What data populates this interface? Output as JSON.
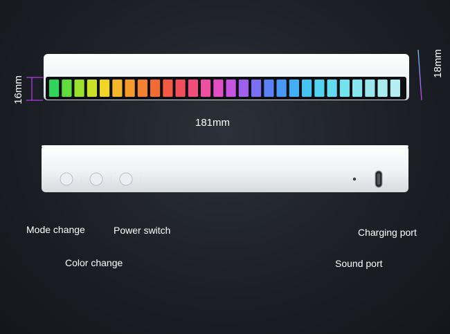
{
  "dimensions": {
    "height_front": "16mm",
    "depth": "18mm",
    "length": "181mm"
  },
  "callouts": {
    "mode_change": "Mode change",
    "color_change": "Color change",
    "power_switch": "Power switch",
    "charging_port": "Charging port",
    "sound_port": "Sound port"
  },
  "led_colors": [
    "#2fd45a",
    "#5fdd3a",
    "#9be02c",
    "#c9e02a",
    "#f0d426",
    "#f6b62a",
    "#f69a2c",
    "#f5802e",
    "#f46a34",
    "#f25a44",
    "#f04e5a",
    "#f04e78",
    "#ec4ea0",
    "#e24fc4",
    "#c654e0",
    "#a060ee",
    "#7c6ef4",
    "#5a82f6",
    "#4a98f6",
    "#44aef4",
    "#44c2f2",
    "#52d4f0",
    "#62dcee",
    "#72e2ee",
    "#86e6ee",
    "#9ae8ee",
    "#a8ecf0",
    "#b4eef2"
  ],
  "colors": {
    "accent": "#c83cf0",
    "device_body": "#f3f4f6",
    "background": "#1b1e24"
  }
}
